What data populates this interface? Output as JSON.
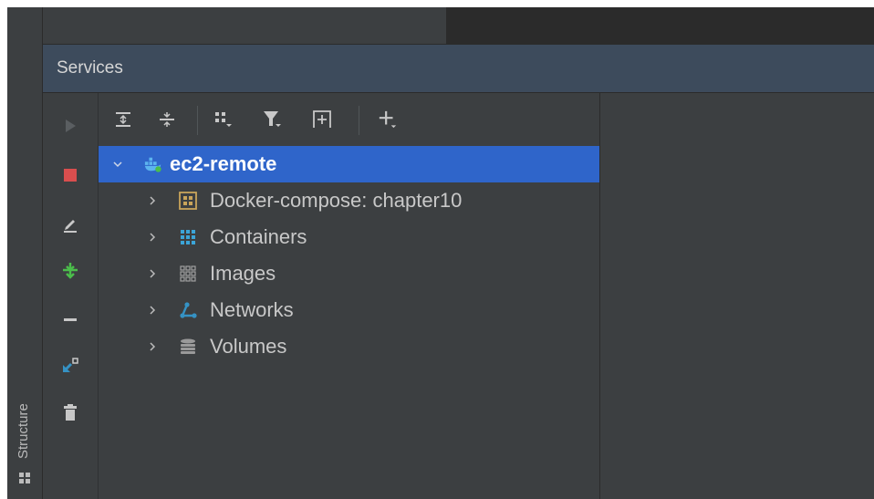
{
  "services_panel": {
    "title": "Services",
    "tree": {
      "root": {
        "label": "ec2-remote",
        "expanded": true,
        "selected": true,
        "icon": "docker-icon"
      },
      "children": [
        {
          "label": "Docker-compose: chapter10",
          "icon": "compose-icon"
        },
        {
          "label": "Containers",
          "icon": "containers-icon"
        },
        {
          "label": "Images",
          "icon": "images-icon"
        },
        {
          "label": "Networks",
          "icon": "networks-icon"
        },
        {
          "label": "Volumes",
          "icon": "volumes-icon"
        }
      ]
    },
    "tree_toolbar": [
      "expand-all-icon",
      "collapse-all-icon",
      "group-by-icon",
      "filter-icon",
      "new-tab-icon",
      "add-icon"
    ],
    "actions": [
      "run-icon",
      "stop-icon",
      "edit-icon",
      "deploy-icon",
      "minus-icon",
      "minimize-icon",
      "delete-icon"
    ]
  },
  "side_stripe": {
    "label": "Structure",
    "icon": "structure-icon"
  },
  "colors": {
    "selection": "#2f65ca",
    "header": "#3d4b5c",
    "background": "#3c3f41",
    "stop": "#d94e4e",
    "deploy": "#4bbd4b",
    "link": "#3592c4"
  }
}
